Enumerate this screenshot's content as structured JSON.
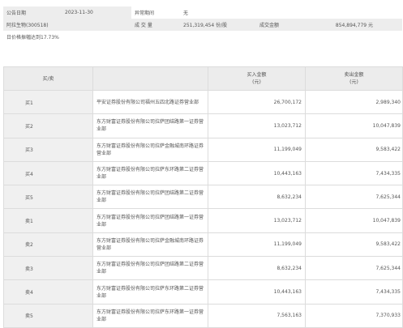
{
  "summary": {
    "date_label": "公告日期",
    "date_value": "2023-11-30",
    "abnormal_label": "异常期间",
    "abnormal_value": "无",
    "stock_label": "阿拉生物(300518)",
    "volume_label": "成 交 量",
    "volume_value": "251,319,454 份/股",
    "amount_label": "成交金额",
    "amount_value": "854,894,779 元",
    "range_text": "日价格振幅达到17.73%"
  },
  "table": {
    "headers": {
      "side": "买/卖",
      "name": "",
      "buy": "买入金额\n(元)",
      "sell": "卖出金额\n(元)"
    },
    "rows": [
      {
        "side": "买1",
        "name": "平安证券股份有限公司福州五四北路证券营业部",
        "buy": "26,700,172",
        "sell": "2,989,340"
      },
      {
        "side": "买2",
        "name": "东方财富证券股份有限公司拉萨团结路第一证券营业部",
        "buy": "13,023,712",
        "sell": "10,047,839"
      },
      {
        "side": "买3",
        "name": "东方财富证券股份有限公司拉萨金融城南环路证券营业部",
        "buy": "11,199,049",
        "sell": "9,583,422"
      },
      {
        "side": "买4",
        "name": "东方财富证券股份有限公司拉萨东环路第二证券营业部",
        "buy": "10,443,163",
        "sell": "7,434,335"
      },
      {
        "side": "买5",
        "name": "东方财富证券股份有限公司拉萨团结路第二证券营业部",
        "buy": "8,632,234",
        "sell": "7,625,344"
      },
      {
        "side": "卖1",
        "name": "东方财富证券股份有限公司拉萨团结路第一证券营业部",
        "buy": "13,023,712",
        "sell": "10,047,839"
      },
      {
        "side": "卖2",
        "name": "东方财富证券股份有限公司拉萨金融城南环路证券营业部",
        "buy": "11,199,049",
        "sell": "9,583,422"
      },
      {
        "side": "卖3",
        "name": "东方财富证券股份有限公司拉萨团结路第二证券营业部",
        "buy": "8,632,234",
        "sell": "7,625,344"
      },
      {
        "side": "卖4",
        "name": "东方财富证券股份有限公司拉萨东环路第二证券营业部",
        "buy": "10,443,163",
        "sell": "7,434,335"
      },
      {
        "side": "卖5",
        "name": "东方财富证券股份有限公司拉萨东环路第一证券营业部",
        "buy": "7,563,163",
        "sell": "7,370,933"
      }
    ]
  }
}
